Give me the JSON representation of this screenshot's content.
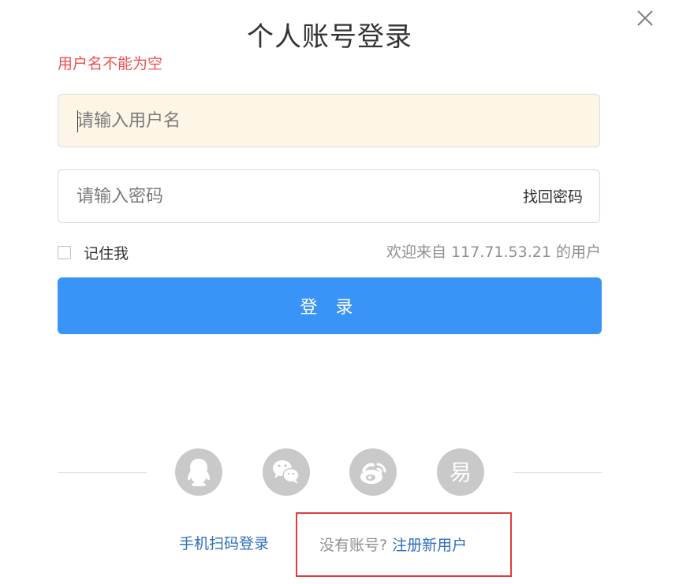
{
  "dialog": {
    "title": "个人账号登录",
    "close_icon": "close-icon",
    "error": "用户名不能为空"
  },
  "form": {
    "username_placeholder": "请输入用户名",
    "username_value": "",
    "password_placeholder": "请输入密码",
    "password_value": "",
    "find_password": "找回密码",
    "remember_me": "记住我",
    "remember_checked": false,
    "welcome": "欢迎来自 117.71.53.21 的用户",
    "login_button": "登 录"
  },
  "social_login": [
    {
      "name": "qq",
      "icon": "qq-icon"
    },
    {
      "name": "wechat",
      "icon": "wechat-icon"
    },
    {
      "name": "weibo",
      "icon": "weibo-icon"
    },
    {
      "name": "yi",
      "icon": "yi-icon",
      "glyph": "易"
    }
  ],
  "footer": {
    "qr_login": "手机扫码登录",
    "no_account": "没有账号?",
    "register": "注册新用户"
  },
  "colors": {
    "primary": "#3a93f7",
    "link": "#2f6fbf",
    "error": "#f04e4e",
    "highlight_border": "#e23b3b",
    "username_bg": "#fdf6e6",
    "social_icon_bg": "#c9c9c9"
  }
}
